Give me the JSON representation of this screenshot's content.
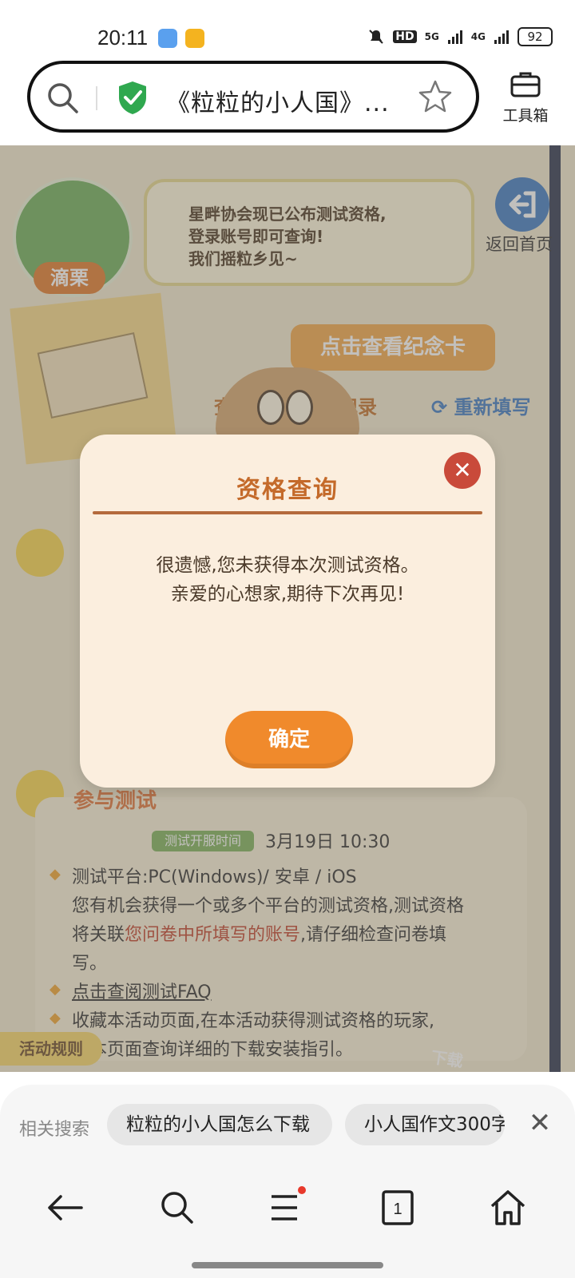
{
  "status_bar": {
    "time": "20:11",
    "network_labels": [
      "5G",
      "4G"
    ],
    "hd_label": "HD",
    "battery": "92"
  },
  "address_bar": {
    "page_title": "《粒粒的小人国》...",
    "toolbox_label": "工具箱"
  },
  "page": {
    "character_tag": "滴栗",
    "bubble_lines": [
      "星畔协会现已公布测试资格,",
      "登录账号即可查询!",
      "我们摇粒乡见~"
    ],
    "back_home": "返回首页",
    "card_button": "点击查看纪念卡",
    "query_partial": "查",
    "record_partial": "记录",
    "refill": "重新填写",
    "section_title": "参与测试",
    "test_time_tag": "测试开服时间",
    "test_time_value": "3月19日 10:30",
    "lines": {
      "platform": "测试平台:PC(Windows)/ 安卓 / iOS",
      "line2": "您有机会获得一个或多个平台的测试资格,测试资格",
      "line3_prefix": "将关联",
      "line3_highlight": "您问卷中所填写的账号",
      "line3_suffix": ",请仔细检查问卷填",
      "line4": "写。",
      "faq_link": "点击查阅测试FAQ",
      "line6": "收藏本活动页面,在本活动获得测试资格的玩家,",
      "line7": "在本页面查询详细的下载安装指引。"
    },
    "rules_tab": "活动规则",
    "download_partial": "下载"
  },
  "modal": {
    "title": "资格查询",
    "message_line1": "很遗憾,您未获得本次测试资格。",
    "message_line2": "亲爱的心想家,期待下次再见!",
    "ok_button": "确定"
  },
  "related_search": {
    "label": "相关搜索",
    "chips": [
      "粒粒的小人国怎么下载",
      "小人国作文300字"
    ]
  },
  "navbar": {
    "tabs_count": "1"
  },
  "colors": {
    "accent_orange": "#f08a2c",
    "modal_title": "#c46a2a",
    "shield_green": "#2fa84f",
    "link_blue": "#3f7bc3"
  }
}
